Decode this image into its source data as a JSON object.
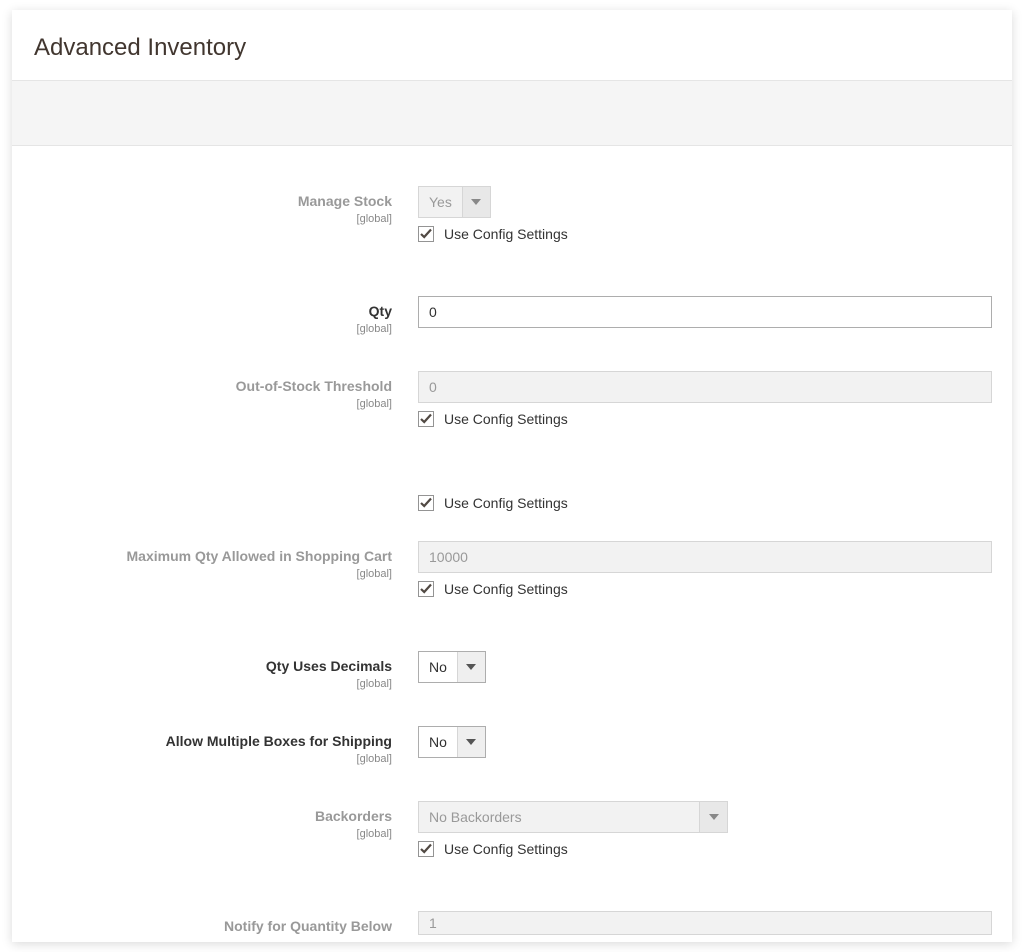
{
  "title": "Advanced Inventory",
  "scope_label": "[global]",
  "use_config_label": "Use Config Settings",
  "fields": {
    "manage_stock": {
      "label": "Manage Stock",
      "value": "Yes"
    },
    "qty": {
      "label": "Qty",
      "value": "0"
    },
    "out_of_stock_threshold": {
      "label": "Out-of-Stock Threshold",
      "value": "0"
    },
    "max_qty_cart": {
      "label": "Maximum Qty Allowed in Shopping Cart",
      "value": "10000"
    },
    "qty_uses_decimals": {
      "label": "Qty Uses Decimals",
      "value": "No"
    },
    "allow_multiple_boxes": {
      "label": "Allow Multiple Boxes for Shipping",
      "value": "No"
    },
    "backorders": {
      "label": "Backorders",
      "value": "No Backorders"
    },
    "notify_qty_below": {
      "label": "Notify for Quantity Below",
      "value": "1"
    }
  }
}
